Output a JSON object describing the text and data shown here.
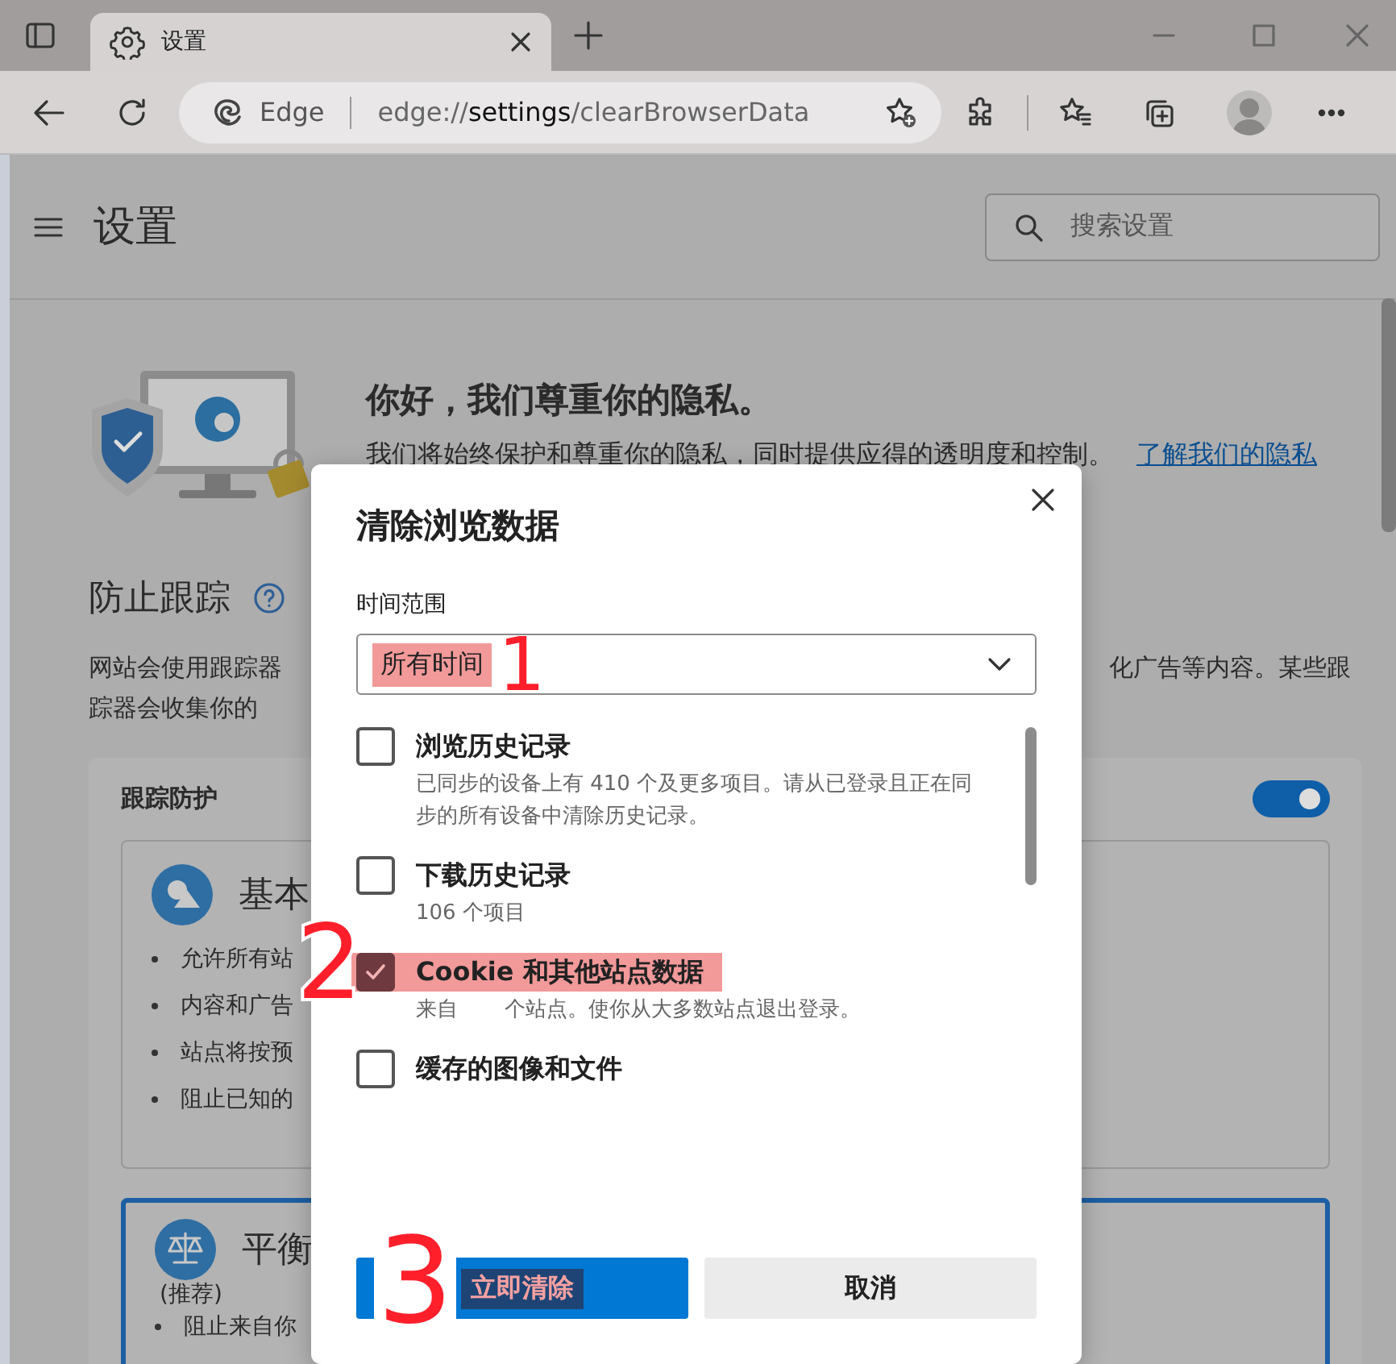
{
  "tab_strip": {
    "tabs": [
      {
        "title": "设置",
        "selected": true
      }
    ]
  },
  "toolbar": {
    "address_label": "Edge",
    "url": {
      "scheme": "edge://",
      "host": "settings",
      "path": "/clearBrowserData"
    }
  },
  "page": {
    "title": "设置",
    "search": {
      "placeholder": "搜索设置"
    },
    "hero": {
      "title": "你好，我们尊重你的隐私。",
      "text": "我们将始终保护和尊重你的隐私，同时提供应得的透明度和控制。",
      "link": "了解我们的隐私"
    },
    "tracking": {
      "title": "防止跟踪",
      "description_left": [
        "网站会使用跟踪器",
        "踪器会收集你的"
      ],
      "description_right": [
        "化广告等内容。某些跟"
      ],
      "card": {
        "title": "跟踪防护",
        "toggle": {
          "on": true
        },
        "levels": [
          {
            "kind": "basic",
            "title": "基本",
            "selected": false,
            "bullets": [
              "允许所有站",
              "内容和广告",
              "站点将按预",
              "阻止已知的"
            ]
          },
          {
            "kind": "balanced",
            "title": "平衡",
            "subtitle": "(推荐)",
            "selected": true,
            "bullets": [
              "阻止来自你"
            ]
          }
        ]
      }
    }
  },
  "dialog": {
    "title": "清除浏览数据",
    "time_range": {
      "label": "时间范围",
      "value": "所有时间",
      "highlighted": true
    },
    "items": [
      {
        "title": "浏览历史记录",
        "description": "已同步的设备上有 410 个及更多项目。请从已登录且正在同步的所有设备中清除历史记录。",
        "checked": false,
        "highlighted": false
      },
      {
        "title": "下载历史记录",
        "description": "106 个项目",
        "checked": false,
        "highlighted": false
      },
      {
        "title": "Cookie 和其他站点数据",
        "description": "来自       个站点。使你从大多数站点退出登录。",
        "checked": true,
        "highlighted": true
      },
      {
        "title": "缓存的图像和文件",
        "checked": false,
        "highlighted": false
      }
    ],
    "buttons": [
      {
        "label": "立即清除",
        "kind": "primary",
        "highlighted": true
      },
      {
        "label": "取消",
        "kind": "secondary",
        "highlighted": false
      }
    ]
  },
  "annotations": [
    {
      "text": "1"
    },
    {
      "text": "2"
    },
    {
      "text": "3"
    }
  ]
}
